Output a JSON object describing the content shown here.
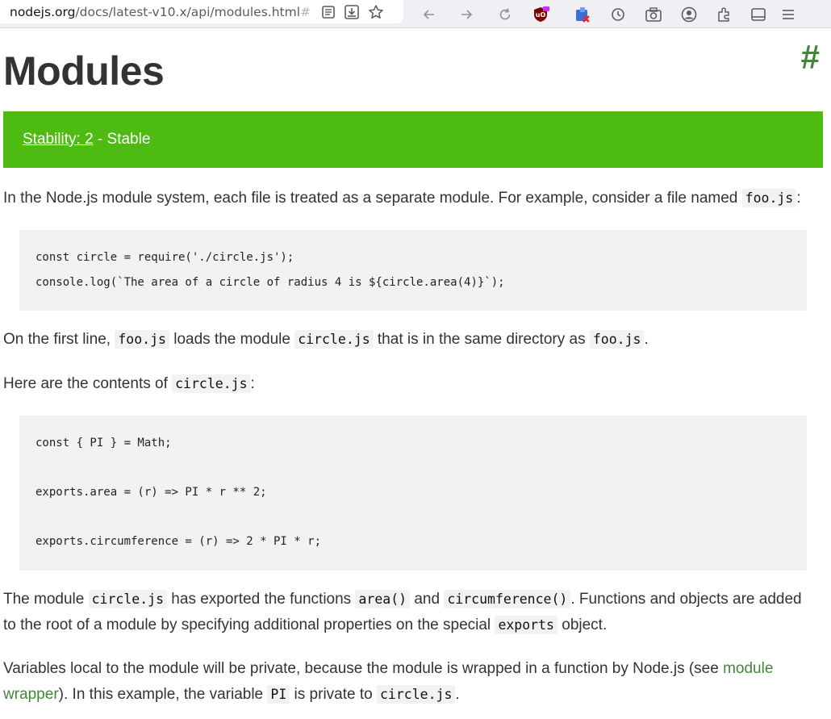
{
  "browser": {
    "url_host": "nodejs.org",
    "url_path": "/docs/latest-v10.x/api/modules.html",
    "url_hash": "#"
  },
  "page": {
    "title": "Modules",
    "anchor": "#",
    "stability": {
      "link": "Stability: 2",
      "text": " - Stable"
    },
    "p1": {
      "text": "In the Node.js module system, each file is treated as a separate module. For example, consider a file named ",
      "code": "foo.js",
      "end": ":"
    },
    "code1": [
      "const circle = require('./circle.js');",
      "console.log(`The area of a circle of radius 4 is ${circle.area(4)}`);"
    ],
    "p2": {
      "t1": "On the first line, ",
      "c1": "foo.js",
      "t2": " loads the module ",
      "c2": "circle.js",
      "t3": " that is in the same directory as ",
      "c3": "foo.js",
      "t4": "."
    },
    "p3": {
      "t1": "Here are the contents of ",
      "c1": "circle.js",
      "t2": ":"
    },
    "code2": [
      "const { PI } = Math;",
      "exports.area = (r) => PI * r ** 2;",
      "exports.circumference = (r) => 2 * PI * r;"
    ],
    "p4": {
      "t1": "The module ",
      "c1": "circle.js",
      "t2": " has exported the functions ",
      "c2": "area()",
      "t3": " and ",
      "c3": "circumference()",
      "t4": ". Functions and objects are added",
      "t5": "to the root of a module by specifying additional properties on the special ",
      "c4": "exports",
      "t6": " object."
    },
    "p5": {
      "t1": "Variables local to the module will be private, because the module is wrapped in a function by Node.js (see ",
      "link1": "module",
      "link2": "wrapper",
      "t2": "). In this example, the variable ",
      "c1": "PI",
      "t3": " is private to ",
      "c2": "circle.js",
      "t4": "."
    }
  },
  "colors": {
    "accent": "#43853d",
    "stability": "#4ebb12",
    "code_bg": "#f2f2f2"
  }
}
